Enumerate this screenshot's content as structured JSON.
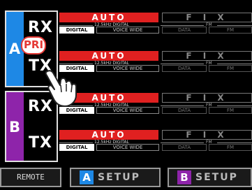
{
  "bands": {
    "a": {
      "letter": "A",
      "tx": "TX",
      "rx": "RX",
      "pri": "PRI",
      "color": "#1e88e5"
    },
    "b": {
      "letter": "B",
      "tx": "TX",
      "rx": "RX",
      "color": "#8e24aa"
    }
  },
  "rows": [
    {
      "auto": "AUTO",
      "fix": "F I X",
      "digital_label": "12.5kHz DIGITAL",
      "fm_label": "FM",
      "modes": [
        "DIGITAL",
        "VOICE WIDE",
        "DATA",
        "FM"
      ]
    },
    {
      "auto": "AUTO",
      "fix": "F I X",
      "digital_label": "12.5kHz DIGITAL",
      "fm_label": "FM",
      "modes": [
        "DIGITAL",
        "VOICE WIDE",
        "DATA",
        "FM"
      ]
    },
    {
      "auto": "AUTO",
      "fix": "F I X",
      "digital_label": "12.5kHz DIGITAL",
      "fm_label": "FM",
      "modes": [
        "DIGITAL",
        "VOICE WIDE",
        "DATA",
        "FM"
      ]
    },
    {
      "auto": "AUTO",
      "fix": "F I X",
      "digital_label": "12.5kHz DIGITAL",
      "fm_label": "FM",
      "modes": [
        "DIGITAL",
        "VOICE WIDE",
        "DATA",
        "FM"
      ]
    }
  ],
  "bottom": {
    "remote": "REMOTE",
    "setup_a_letter": "A",
    "setup_a_label": "SETUP",
    "setup_b_letter": "B",
    "setup_b_label": "SETUP"
  },
  "colors": {
    "auto_active": "#e02020",
    "band_a": "#1e88e5",
    "band_b": "#8e24aa"
  },
  "icons": {
    "pointer": "hand-pointer-icon"
  }
}
